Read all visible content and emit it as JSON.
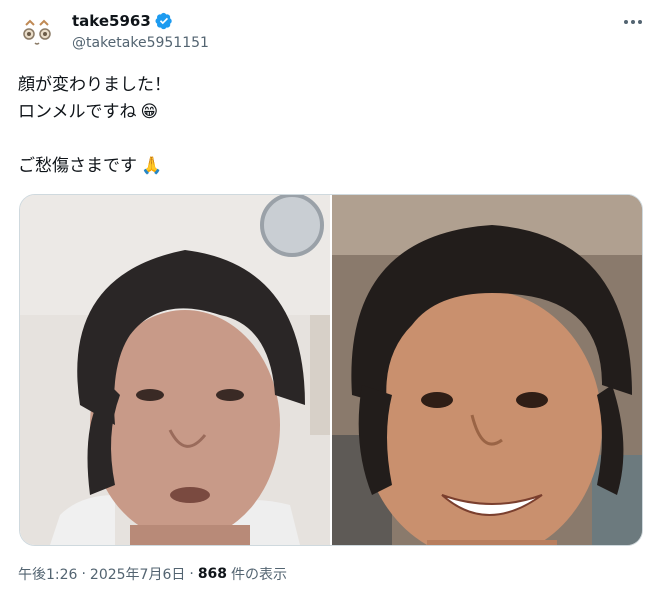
{
  "user": {
    "display_name": "take5963",
    "handle": "@taketake5951151",
    "verified": true
  },
  "tweet": {
    "lines": [
      "顔が変わりました！",
      "ロンメルですね",
      "",
      "ご愁傷さまです"
    ],
    "emoji_line2": "😁",
    "emoji_line4": "🙏"
  },
  "media": {
    "images": [
      {
        "icon": "photo-before"
      },
      {
        "icon": "photo-after"
      }
    ]
  },
  "meta": {
    "time": "午後1:26",
    "sep1": "·",
    "date": "2025年7月6日",
    "sep2": "·",
    "views": "868",
    "views_label": "件の表示"
  },
  "colors": {
    "verified": "#1d9bf0",
    "secondary": "#536471",
    "text": "#0f1419",
    "border": "#cfd9de"
  }
}
